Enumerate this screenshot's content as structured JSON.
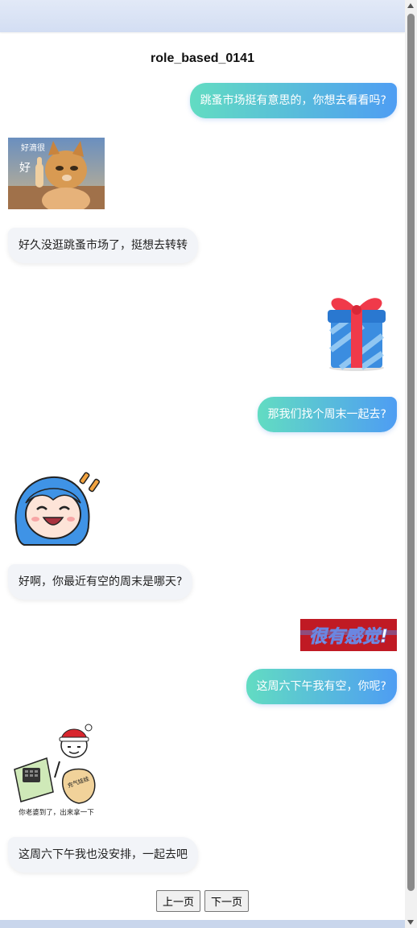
{
  "page_title": "role_based_0141",
  "messages": [
    {
      "side": "right",
      "text": "跳蚤市场挺有意思的，你想去看看吗?"
    },
    {
      "side": "left",
      "sticker": "cat-thumbs-up-sticker",
      "caption_top": "好滴很",
      "caption_side": "好"
    },
    {
      "side": "left",
      "text": "好久没逛跳蚤市场了，挺想去转转"
    },
    {
      "side": "right",
      "sticker": "gift-box-sticker"
    },
    {
      "side": "right",
      "text": "那我们找个周末一起去?"
    },
    {
      "side": "left",
      "sticker": "anime-girl-laughing-sticker"
    },
    {
      "side": "left",
      "text": "好啊，你最近有空的周末是哪天?"
    },
    {
      "side": "right",
      "sticker": "hen-you-gan-jue-sticker",
      "caption": "很有感觉!"
    },
    {
      "side": "right",
      "text": "这周六下午我有空，你呢?"
    },
    {
      "side": "left",
      "sticker": "delivery-meme-sticker",
      "caption": "你老婆到了，出来拿一下",
      "bag_text": "充气娃娃"
    },
    {
      "side": "left",
      "text": "这周六下午我也没安排，一起去吧"
    }
  ],
  "pager": {
    "prev_label": "上一页",
    "next_label": "下一页"
  },
  "colors": {
    "bubble_gradient_start": "#62dcc2",
    "bubble_gradient_end": "#4e9df3",
    "left_bubble": "#f2f4f8"
  }
}
